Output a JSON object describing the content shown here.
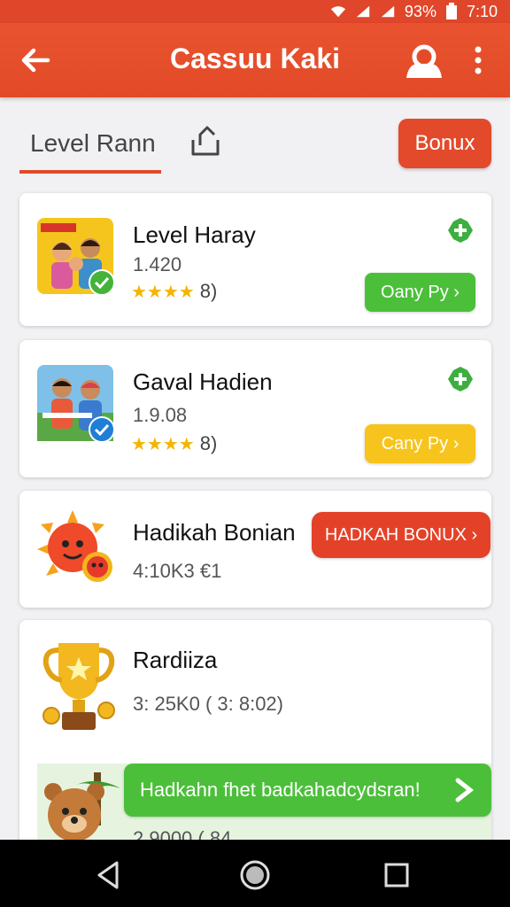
{
  "status": {
    "battery": "93%",
    "time": "7:10"
  },
  "appbar": {
    "title": "Cassuu Kaki"
  },
  "tabs": {
    "level_label": "Level Rann",
    "bonus_label": "Bonux"
  },
  "cards": [
    {
      "name": "Level Haray",
      "sub": "1.420",
      "stars": "★★★★",
      "rating_count": "8)",
      "button": "Oany Py ›"
    },
    {
      "name": "Gaval Hadien",
      "sub": "1.9.08",
      "stars": "★★★★",
      "rating_count": "8)",
      "button": "Cany Py ›"
    },
    {
      "name": "Hadikah Bonian",
      "sub": "4:10K3 €1",
      "button": "HADKAH BONUX ›"
    },
    {
      "name": "Rardiiza",
      "sub": "3: 25K0 ( 3: 8:02)",
      "banner": "Hadkahn fhet badkahadcydsran!",
      "partial": "2.9000 ( 84"
    }
  ],
  "colors": {
    "accent": "#e24a28",
    "green": "#4cbf3a",
    "yellow": "#f6c41c"
  }
}
